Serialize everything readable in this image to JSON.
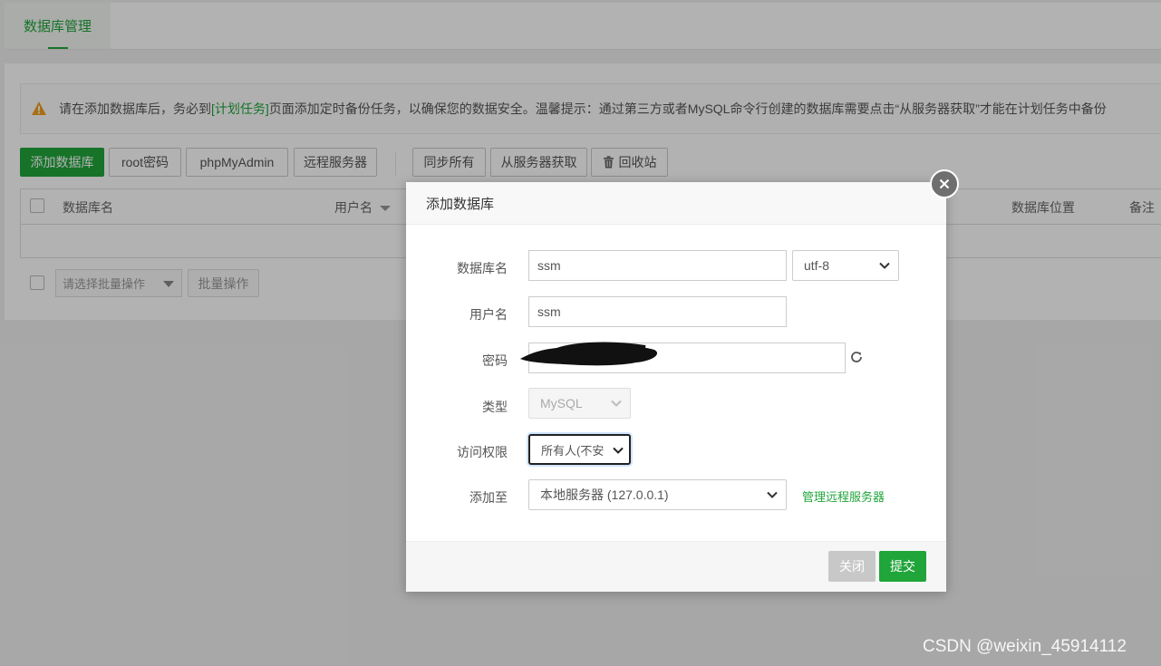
{
  "top_tab": {
    "label": "数据库管理"
  },
  "alert": {
    "prefix": "请在添加数据库后，务必到",
    "link": "[计划任务]",
    "suffix": "页面添加定时备份任务，以确保您的数据安全。温馨提示：通过第三方或者MySQL命令行创建的数据库需要点击“从服务器获取”才能在计划任务中备份"
  },
  "toolbar": {
    "add_db": "添加数据库",
    "root_pwd": "root密码",
    "phpmyadmin": "phpMyAdmin",
    "remote": "远程服务器",
    "sync_all": "同步所有",
    "fetch_server": "从服务器获取",
    "recycle": "回收站"
  },
  "table": {
    "headers": {
      "name": "数据库名",
      "user": "用户名",
      "location": "数据库位置",
      "remark": "备注"
    }
  },
  "batch": {
    "placeholder": "请选择批量操作",
    "button": "批量操作"
  },
  "modal": {
    "title": "添加数据库",
    "labels": {
      "db_name": "数据库名",
      "username": "用户名",
      "password": "密码",
      "type": "类型",
      "access": "访问权限",
      "add_to": "添加至"
    },
    "values": {
      "db_name": "ssm",
      "charset": "utf-8",
      "username": "ssm",
      "type": "MySQL",
      "access": "所有人(不安",
      "add_to": "本地服务器 (127.0.0.1)"
    },
    "manage_remote_link": "管理远程服务器",
    "close_button": "关闭",
    "submit_button": "提交"
  },
  "watermark": "CSDN @weixin_45914112",
  "colors": {
    "accent": "#20a53a",
    "warning": "#f0a020"
  }
}
